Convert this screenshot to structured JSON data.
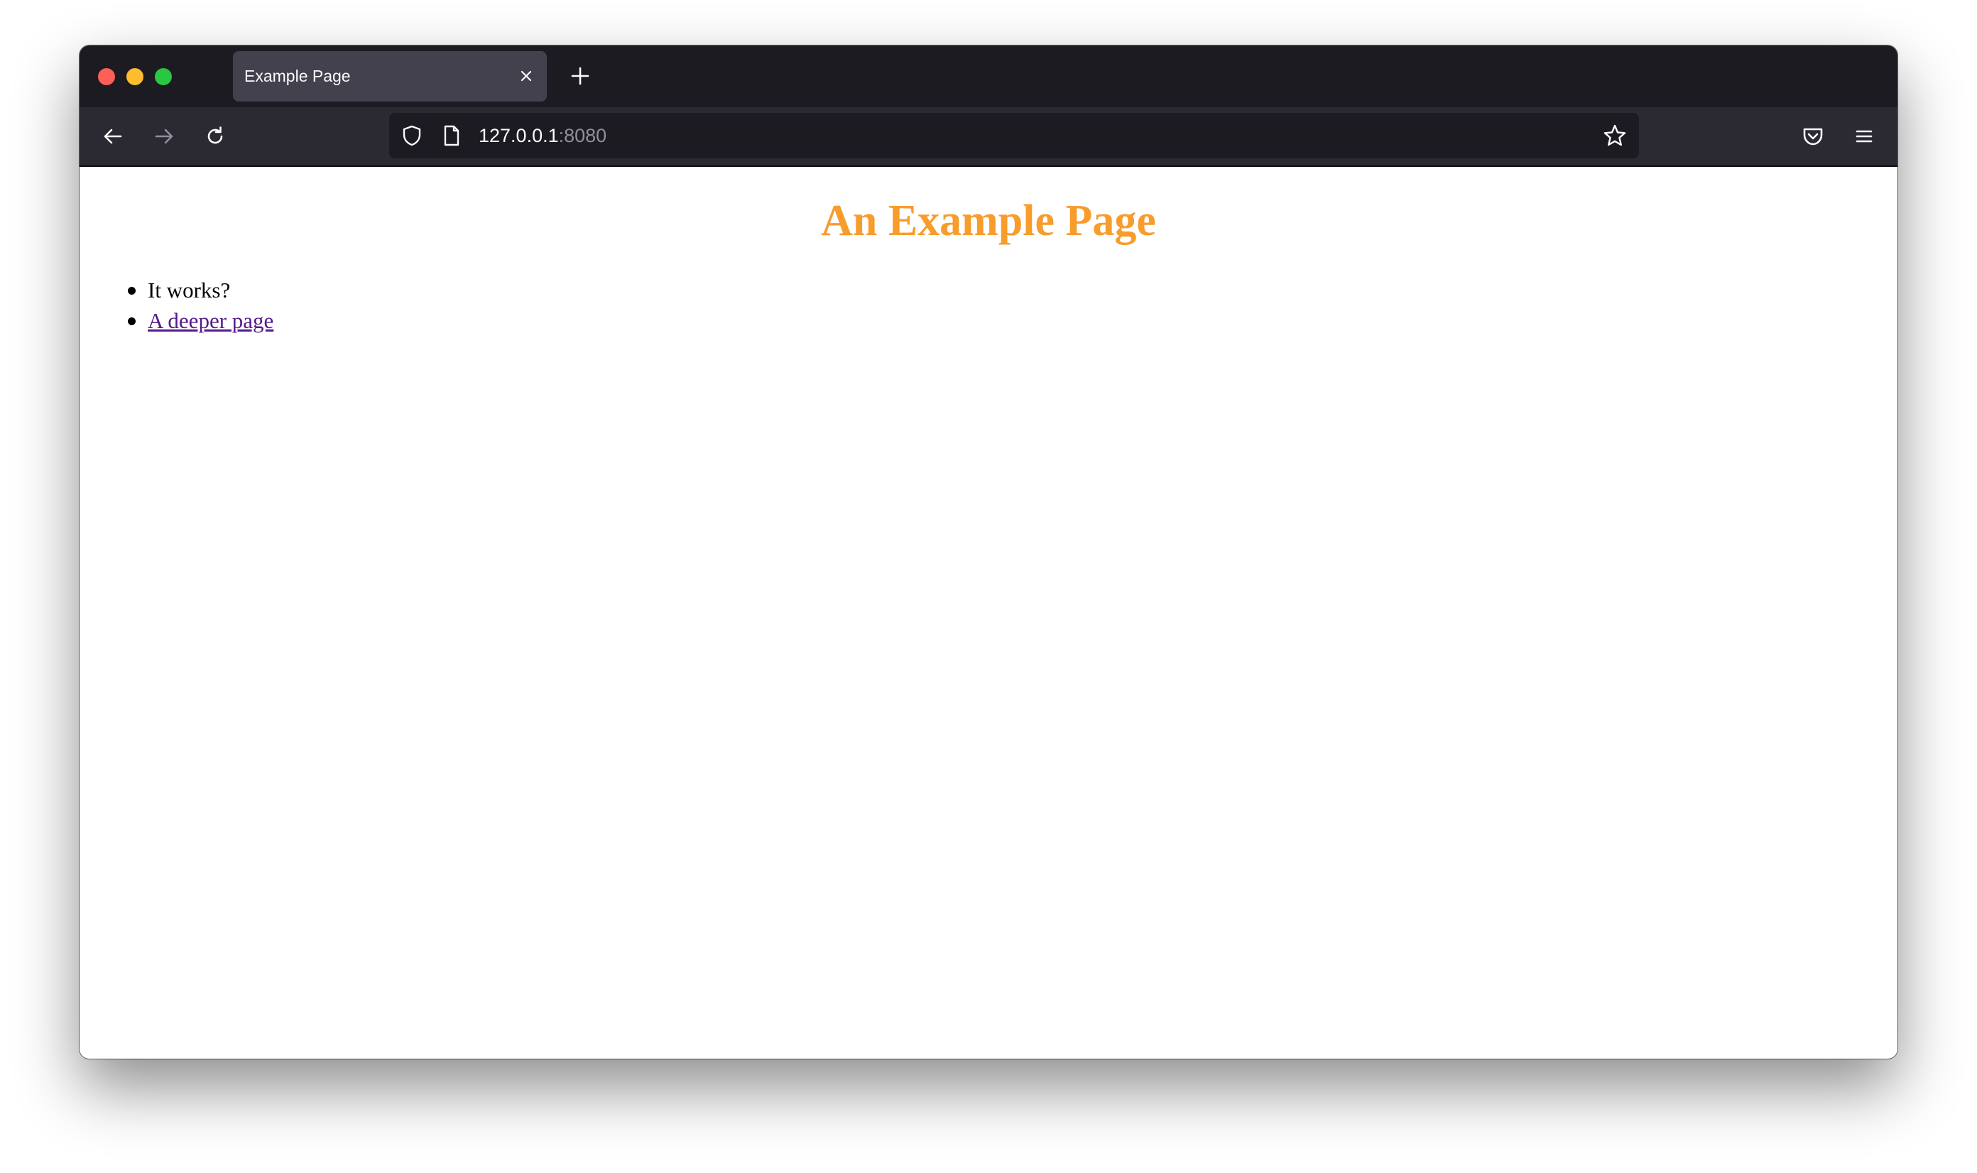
{
  "browser": {
    "tab": {
      "title": "Example Page"
    },
    "url": {
      "host": "127.0.0.1",
      "port": ":8080"
    },
    "icons": {
      "close_tab": "close-icon",
      "new_tab": "plus-icon",
      "back": "arrow-left-icon",
      "forward": "arrow-right-icon",
      "reload": "reload-icon",
      "tracking": "shield-icon",
      "page": "page-icon",
      "bookmark": "star-icon",
      "pocket": "pocket-icon",
      "menu": "hamburger-menu-icon"
    }
  },
  "page": {
    "title": "An Example Page",
    "title_color": "#f89c2c",
    "items": [
      {
        "text": "It works?"
      },
      {
        "text": "A deeper page",
        "visited_link_color": "#551a8b"
      }
    ]
  }
}
